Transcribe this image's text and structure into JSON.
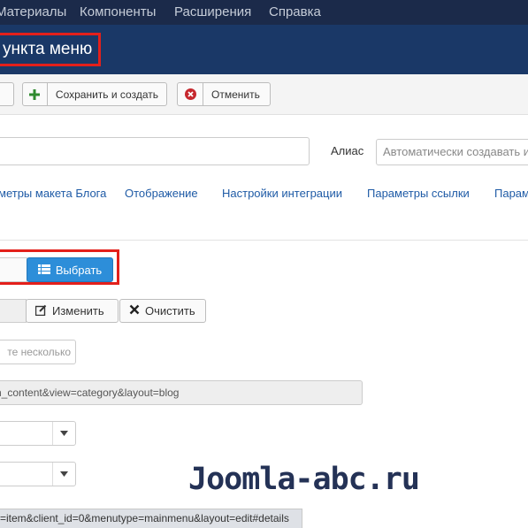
{
  "topnav": {
    "items": [
      "Материалы",
      "Компоненты",
      "Расширения",
      "Справка"
    ]
  },
  "header": {
    "title": "ункта меню"
  },
  "toolbar": {
    "save_and_new": "Сохранить и создать",
    "cancel": "Отменить"
  },
  "details": {
    "alias_label": "Алиас",
    "alias_placeholder": "Автоматически создавать из заголовка"
  },
  "tabs": [
    "метры макета Блога",
    "Отображение",
    "Настройки интеграции",
    "Параметры ссылки",
    "Парам"
  ],
  "menu_item_type": {
    "select_label": "Выбрать"
  },
  "link_buttons": {
    "edit": "Изменить",
    "clear": "Очистить"
  },
  "note_placeholder": "те несколько",
  "link_value": "n_content&view=category&layout=blog",
  "watermark": "Joomla-abc.ru",
  "status_url": "=item&client_id=0&menutype=mainmenu&layout=edit#details",
  "colors": {
    "header": "#1a3867",
    "topnav": "#1b2a4a",
    "primary": "#2d8ed9",
    "highlight": "#e3201b"
  }
}
